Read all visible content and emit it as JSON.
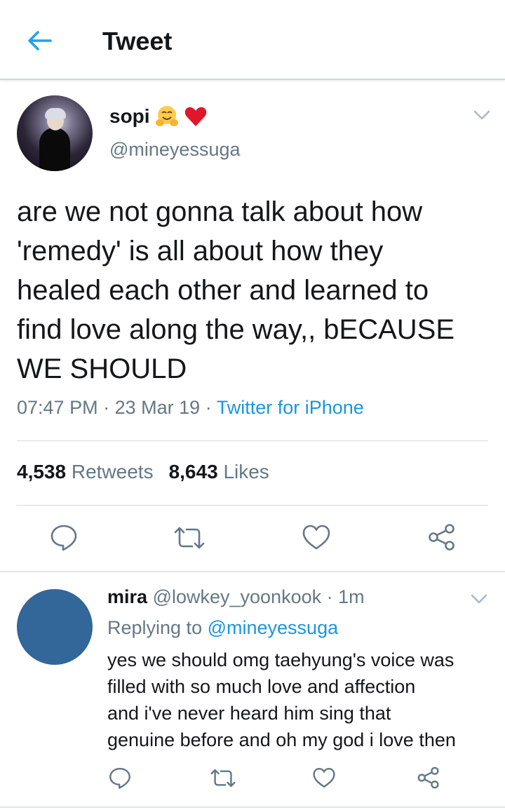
{
  "header": {
    "back_icon": "arrow-left-icon",
    "title": "Tweet",
    "accent_color": "#1da1f2"
  },
  "tweet": {
    "display_name": "sopi",
    "name_emojis": [
      "hugging-face-icon",
      "red-heart-icon"
    ],
    "handle": "@mineyessuga",
    "text": "are we not gonna talk about how\n'remedy' is all about how they\nhealed each other and learned to\nfind love along the way,, bECAUSE\nWE SHOULD",
    "time": "07:47 PM",
    "sep1": "·",
    "date": "23 Mar 19",
    "sep2": "·",
    "source": "Twitter for iPhone",
    "retweets_count": "4,538",
    "retweets_label": "Retweets",
    "likes_count": "8,643",
    "likes_label": "Likes",
    "actions": [
      "reply-icon",
      "retweet-icon",
      "like-icon",
      "share-icon"
    ]
  },
  "reply": {
    "display_name": "mira",
    "handle": "@lowkey_yoonkook",
    "sep": "·",
    "time_ago": "1m",
    "replying_prefix": "Replying to",
    "replying_to": "@mineyessuga",
    "text": "yes we should omg taehyung's voice was\nfilled with so much love and affection\nand i've never heard him sing that\ngenuine before and oh my god i love then",
    "avatar_color": "#336699",
    "actions": [
      "reply-icon",
      "retweet-icon",
      "like-icon",
      "share-icon"
    ]
  }
}
